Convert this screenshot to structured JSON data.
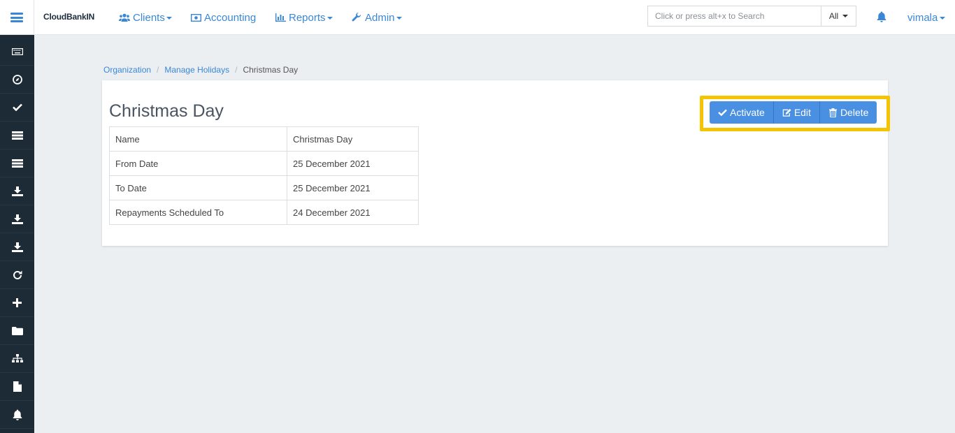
{
  "app": {
    "brand": "CloudBankIN"
  },
  "nav": {
    "clients": "Clients",
    "accounting": "Accounting",
    "reports": "Reports",
    "admin": "Admin"
  },
  "search": {
    "placeholder": "Click or press alt+x to Search",
    "scope": "All"
  },
  "user": {
    "name": "vimala"
  },
  "breadcrumb": {
    "items": [
      "Organization",
      "Manage Holidays"
    ],
    "current": "Christmas Day"
  },
  "holiday": {
    "title": "Christmas Day",
    "rows": [
      {
        "label": "Name",
        "value": "Christmas Day"
      },
      {
        "label": "From Date",
        "value": "25 December 2021"
      },
      {
        "label": "To Date",
        "value": "25 December 2021"
      },
      {
        "label": "Repayments Scheduled To",
        "value": "24 December 2021"
      }
    ]
  },
  "actions": {
    "activate": "Activate",
    "edit": "Edit",
    "delete": "Delete"
  },
  "sidebar": {
    "icons": [
      "keyboard-icon",
      "compass-icon",
      "check-icon",
      "server-icon",
      "server-icon",
      "download-icon",
      "download-icon",
      "download-icon",
      "refresh-icon",
      "plus-icon",
      "folder-icon",
      "sitemap-icon",
      "file-icon",
      "bell-icon"
    ]
  },
  "colors": {
    "accent": "#3a87d6",
    "button": "#4a90e2",
    "sidebar": "#1c2b36",
    "highlight": "#f5c400"
  }
}
